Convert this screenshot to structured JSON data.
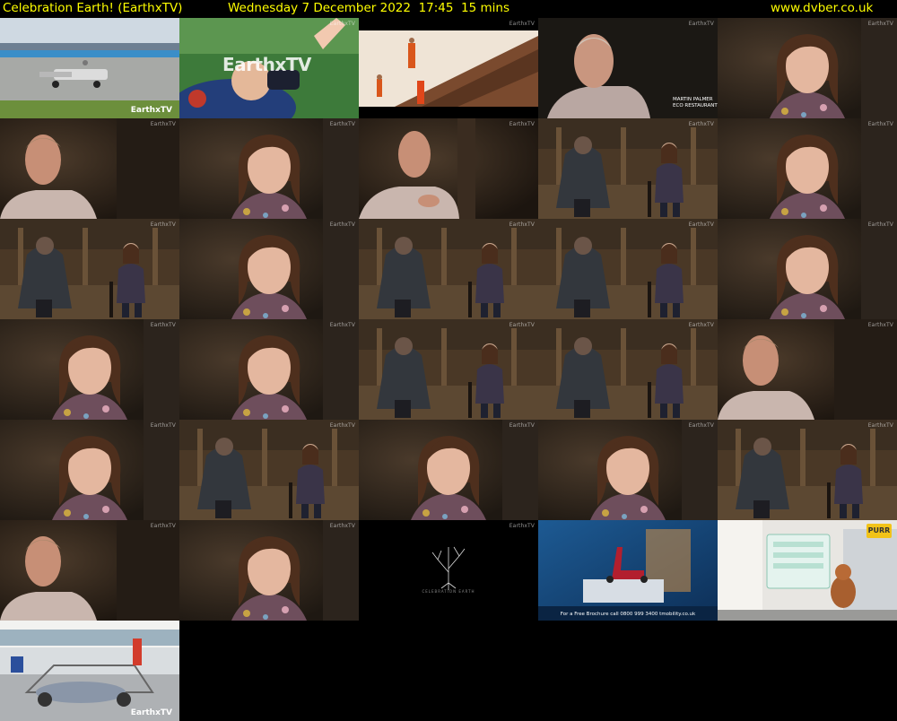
{
  "header": {
    "title": "Celebration Earth! (EarthxTV)",
    "datetime": "Wednesday 7 December 2022  17:45  15 mins",
    "site": "www.dvber.co.uk"
  },
  "thumbnails": [
    {
      "scene": "solar-car-race",
      "logo": "EarthxTV"
    },
    {
      "scene": "child-vr-headset",
      "overlay": "EarthxTV",
      "logo": "EarthxTV"
    },
    {
      "scene": "monks-thatched-roof",
      "logo": "EarthxTV"
    },
    {
      "scene": "older-man-interview",
      "logo": "EarthxTV",
      "caption_line1": "MARTIN PALMER",
      "caption_line2": "ECO RESTAURANT"
    },
    {
      "scene": "woman-interview",
      "logo": "EarthxTV"
    },
    {
      "scene": "older-man-closeup",
      "logo": "EarthxTV"
    },
    {
      "scene": "woman-interview",
      "logo": "EarthxTV"
    },
    {
      "scene": "older-man-gesturing",
      "logo": "EarthxTV"
    },
    {
      "scene": "two-seated-wide",
      "logo": "EarthxTV"
    },
    {
      "scene": "woman-interview",
      "logo": "EarthxTV"
    },
    {
      "scene": "two-seated-wide",
      "logo": "EarthxTV"
    },
    {
      "scene": "woman-interview",
      "logo": "EarthxTV"
    },
    {
      "scene": "two-seated-wide",
      "logo": "EarthxTV"
    },
    {
      "scene": "two-seated-wide",
      "logo": "EarthxTV"
    },
    {
      "scene": "woman-interview",
      "logo": "EarthxTV"
    },
    {
      "scene": "woman-interview",
      "logo": "EarthxTV"
    },
    {
      "scene": "woman-interview",
      "logo": "EarthxTV"
    },
    {
      "scene": "two-seated-wide",
      "logo": "EarthxTV"
    },
    {
      "scene": "two-seated-wide",
      "logo": "EarthxTV"
    },
    {
      "scene": "older-man-closeup",
      "logo": "EarthxTV"
    },
    {
      "scene": "woman-interview",
      "logo": "EarthxTV"
    },
    {
      "scene": "two-seated-wide",
      "logo": "EarthxTV"
    },
    {
      "scene": "woman-interview",
      "logo": "EarthxTV"
    },
    {
      "scene": "woman-interview",
      "logo": "EarthxTV"
    },
    {
      "scene": "two-seated-wide",
      "logo": "EarthxTV"
    },
    {
      "scene": "older-man-closeup",
      "logo": "EarthxTV"
    },
    {
      "scene": "woman-interview",
      "logo": "EarthxTV"
    },
    {
      "scene": "tree-logo",
      "logo": "EarthxTV",
      "tree_caption": "CELEBRATION EARTH"
    },
    {
      "scene": "mobility-scooter-ad",
      "promo": "For a Free Brochure call 0800 999 3400  tmobility.co.uk"
    },
    {
      "scene": "purr-dog-ad",
      "badge": "PURR"
    },
    {
      "scene": "workshop-car",
      "logo": "EarthxTV"
    }
  ],
  "colors": {
    "header_text": "#ffff00",
    "background": "#000000"
  }
}
